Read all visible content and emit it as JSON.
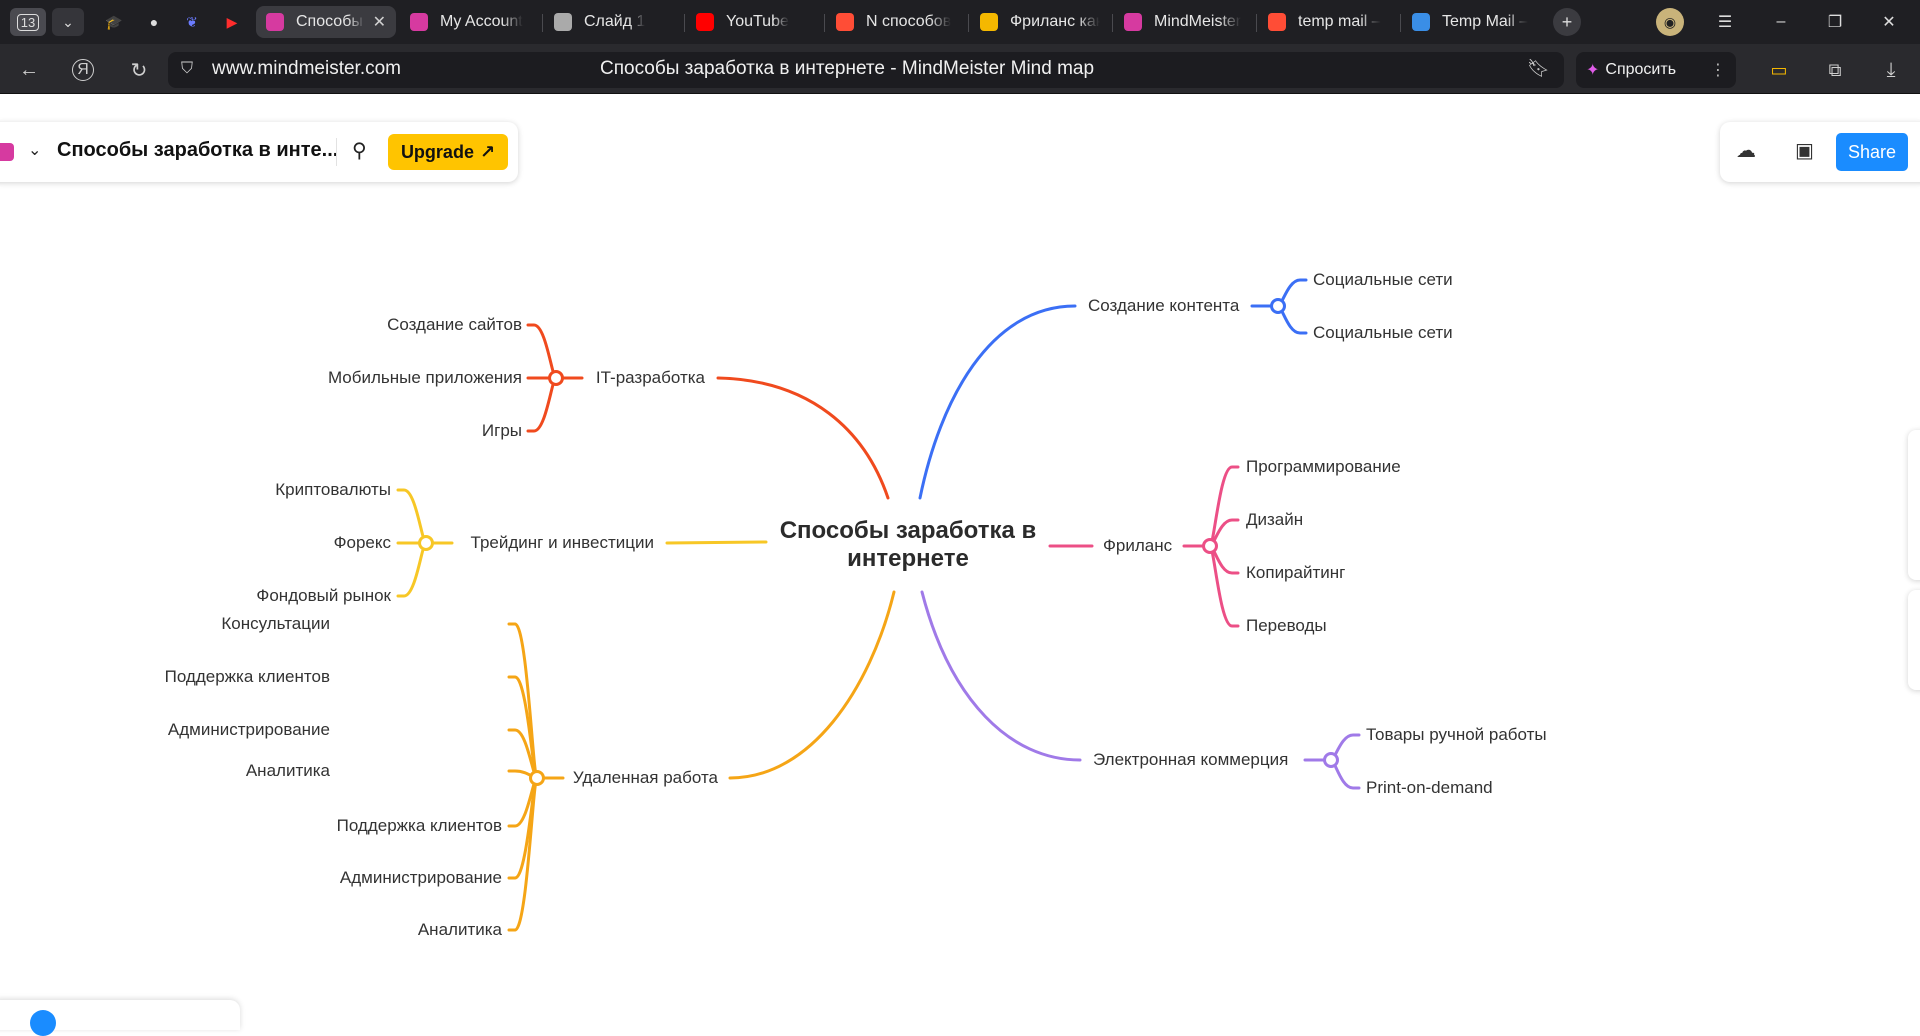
{
  "browser": {
    "tab_counter": "13",
    "tabs": [
      {
        "title": "Способы заработка в интернете",
        "active": true,
        "icon": "mindmeister-icon",
        "color": "#d63aa0"
      },
      {
        "title": "My Account",
        "active": false,
        "icon": "mindmeister-icon",
        "color": "#d63aa0"
      },
      {
        "title": "Слайд 1",
        "active": false,
        "icon": "document-icon",
        "color": "#aaaaaa"
      },
      {
        "title": "YouTube",
        "active": false,
        "icon": "youtube-icon",
        "color": "#ff0000"
      },
      {
        "title": "N способов",
        "active": false,
        "icon": "yandex-icon",
        "color": "#ff4d36"
      },
      {
        "title": "Фриланс как",
        "active": false,
        "icon": "image-icon",
        "color": "#f5b800"
      },
      {
        "title": "MindMeister",
        "active": false,
        "icon": "mindmeister-icon",
        "color": "#d63aa0"
      },
      {
        "title": "temp mail –",
        "active": false,
        "icon": "yandex-icon",
        "color": "#ff4d36"
      },
      {
        "title": "Temp Mail –",
        "active": false,
        "icon": "mail-icon",
        "color": "#3a8ee6"
      }
    ],
    "url": "www.mindmeister.com",
    "page_title": "Способы заработка в интернете - MindMeister Mind map",
    "ask_label": "Спросить"
  },
  "app": {
    "map_name": "Способы заработка в инте...",
    "upgrade_label": "Upgrade",
    "share_label": "Share"
  },
  "mindmap": {
    "root": "Способы заработка в интернете",
    "colors": {
      "it": "#f04a1e",
      "trading": "#f7c726",
      "remote": "#f5a516",
      "content": "#3b6ff5",
      "freelance": "#ec4f86",
      "ecommerce": "#a07ae8"
    },
    "branches": {
      "it": {
        "label": "IT-разработка",
        "children": [
          "Создание сайтов",
          "Мобильные приложения",
          "Игры"
        ]
      },
      "trading": {
        "label": "Трейдинг и инвестиции",
        "children": [
          "Криптовалюты",
          "Форекс",
          "Фондовый рынок"
        ]
      },
      "remote": {
        "label": "Удаленная работа",
        "children": [
          "Консультации",
          "Поддержка клиентов",
          "Администрирование",
          "Аналитика",
          "Поддержка клиентов",
          "Администрирование",
          "Аналитика"
        ]
      },
      "content": {
        "label": "Создание контента",
        "children": [
          "Социальные сети",
          "Социальные сети"
        ]
      },
      "freelance": {
        "label": "Фриланс",
        "children": [
          "Программирование",
          "Дизайн",
          "Копирайтинг",
          "Переводы"
        ]
      },
      "ecommerce": {
        "label": "Электронная коммерция",
        "children": [
          "Товары ручной работы",
          "Print-on-demand"
        ]
      }
    }
  }
}
